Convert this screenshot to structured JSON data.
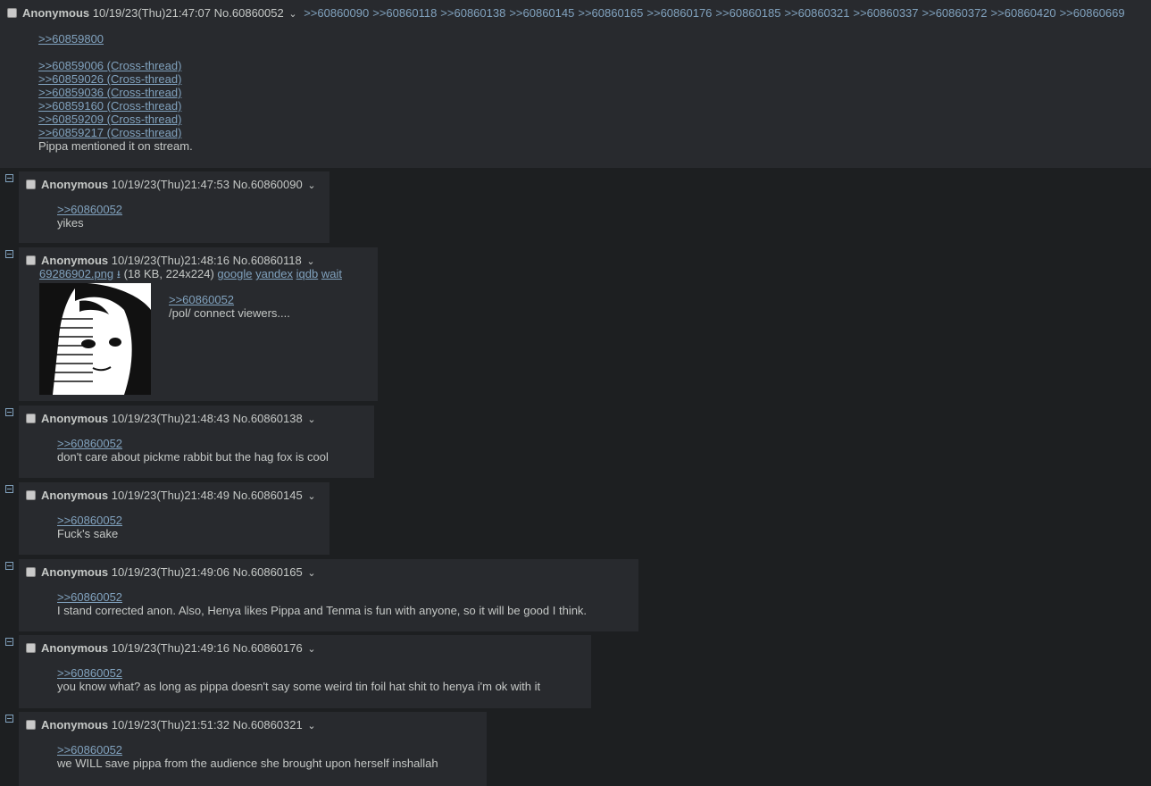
{
  "op": {
    "name": "Anonymous",
    "datetime": "10/19/23(Thu)21:47:07",
    "number": "No.60860052",
    "backlinks": [
      ">>60860090",
      ">>60860118",
      ">>60860138",
      ">>60860145",
      ">>60860165",
      ">>60860176",
      ">>60860185",
      ">>60860321",
      ">>60860337",
      ">>60860372",
      ">>60860420",
      ">>60860669"
    ],
    "quote": ">>60859800",
    "cross_links": [
      ">>60859006 (Cross-thread)",
      ">>60859026 (Cross-thread)",
      ">>60859036 (Cross-thread)",
      ">>60859160 (Cross-thread)",
      ">>60859209 (Cross-thread)",
      ">>60859217 (Cross-thread)"
    ],
    "text": "Pippa mentioned it on stream."
  },
  "replies": [
    {
      "name": "Anonymous",
      "datetime": "10/19/23(Thu)21:47:53",
      "number": "No.60860090",
      "quote": ">>60860052",
      "text": "yikes"
    },
    {
      "name": "Anonymous",
      "datetime": "10/19/23(Thu)21:48:16",
      "number": "No.60860118",
      "quote": ">>60860052",
      "text": "/pol/ connect viewers....",
      "file": {
        "filename": "69286902.png",
        "download_icon": "download-icon",
        "meta": "(18 KB, 224x224)",
        "links": [
          "google",
          "yandex",
          "iqdb",
          "wait"
        ]
      }
    },
    {
      "name": "Anonymous",
      "datetime": "10/19/23(Thu)21:48:43",
      "number": "No.60860138",
      "quote": ">>60860052",
      "text": "don't care about pickme rabbit but the hag fox is cool"
    },
    {
      "name": "Anonymous",
      "datetime": "10/19/23(Thu)21:48:49",
      "number": "No.60860145",
      "quote": ">>60860052",
      "text": "Fuck's sake"
    },
    {
      "name": "Anonymous",
      "datetime": "10/19/23(Thu)21:49:06",
      "number": "No.60860165",
      "quote": ">>60860052",
      "text": "I stand corrected anon. Also, Henya likes Pippa and Tenma is fun with anyone, so it will be good I think."
    },
    {
      "name": "Anonymous",
      "datetime": "10/19/23(Thu)21:49:16",
      "number": "No.60860176",
      "quote": ">>60860052",
      "text": "you know what? as long as pippa doesn't say some weird tin foil hat shit to henya i'm ok with it"
    },
    {
      "name": "Anonymous",
      "datetime": "10/19/23(Thu)21:51:32",
      "number": "No.60860321",
      "quote": ">>60860052",
      "text": "we WILL save pippa from the audience she brought upon herself inshallah"
    }
  ],
  "colors": {
    "background": "#1d1f21",
    "post": "#282a2e",
    "link": "#81a2be",
    "text": "#c5c8c6"
  }
}
